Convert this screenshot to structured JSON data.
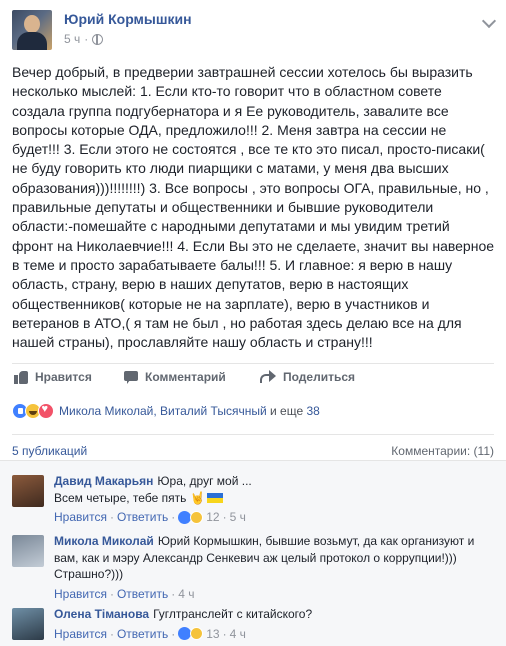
{
  "post": {
    "author": "Юрий Кормышкин",
    "time": "5 ч",
    "text": "Вечер добрый, в предверии завтрашней сессии хотелось бы выразить несколько мыслей: 1. Если кто-то говорит что в областном совете создала группа подгубернатора и я Ее руководитель, завалите все вопросы которые ОДА, предложило!!! 2. Меня завтра на сессии не будет!!! 3. Если этого не состоятся , все те кто это писал, просто-писаки( не буду говорить кто люди пиарщики с матами, у меня два высших образования)))!!!!!!!!) 3. Все вопросы , это вопросы ОГА, правильные, но , правильные депутаты и общественники и бывшие руководители области:-помешайте с народными депутатами и мы увидим третий фронт на Николаевчие!!! 4. Если Вы это не сделаете, значит вы наверное в теме и просто зарабатываете балы!!! 5. И главное: я верю в нашу область, страну, верю в наших депутатов, верю в настоящих общественников( которые не на зарплате), верю в участников и ветеранов в АТО,( я там не был , но работая здесь делаю все на для нашей страны), прославляйте нашу область и страну!!!"
  },
  "actions": {
    "like": "Нравится",
    "comment": "Комментарий",
    "share": "Поделиться"
  },
  "reactions": {
    "names": "Микола Миколай, Виталий Тысячный",
    "connector": " и еще ",
    "count": "38"
  },
  "counts": {
    "shares": "5 публикаций",
    "comments": "Комментарии: (11)"
  },
  "comments": [
    {
      "name": "Давид Макарьян",
      "text": "Юра, друг мой ...",
      "text2": "Всем четыре, тебе пять",
      "hand": "🤘",
      "like": "Нравится",
      "reply": "Ответить",
      "reacts": "12",
      "time": "5 ч"
    },
    {
      "name": "Микола Миколай",
      "text": "Юрий Кормышкин, бывшие возьмут, да как организуют и вам, как и мэру Александр Сенкевич аж целый протокол о коррупции!))) Страшно?)))",
      "like": "Нравится",
      "reply": "Ответить",
      "time": "4 ч"
    },
    {
      "name": "Олена Тіманова",
      "text": "Гуглтранслейт с китайского?",
      "like": "Нравится",
      "reply": "Ответить",
      "reacts": "13",
      "time": "4 ч"
    }
  ],
  "sep": "·"
}
